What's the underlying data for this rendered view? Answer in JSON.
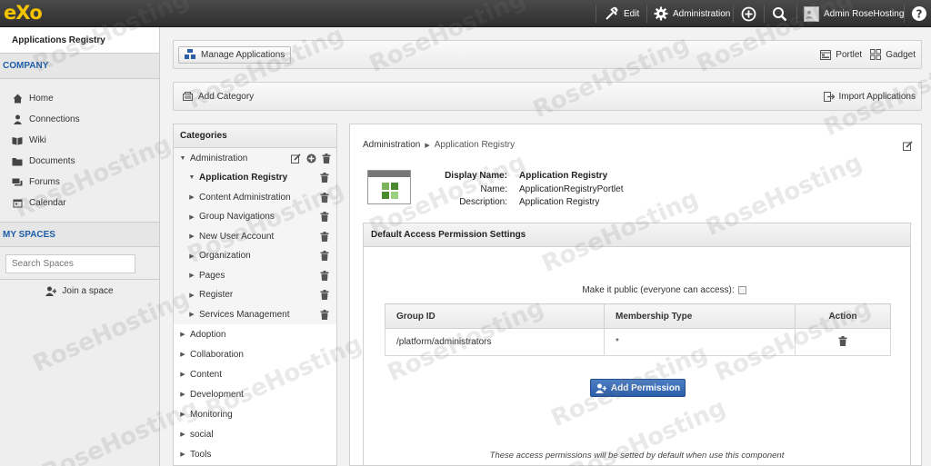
{
  "topbar": {
    "logo": "eXo",
    "edit_label": "Edit",
    "administration_label": "Administration",
    "user_label": "Admin RoseHosting"
  },
  "sidebar": {
    "app_title": "Applications Registry",
    "company_title": "COMPANY",
    "nav_items": [
      {
        "label": "Home",
        "icon": "home-icon"
      },
      {
        "label": "Connections",
        "icon": "user-icon"
      },
      {
        "label": "Wiki",
        "icon": "book-icon"
      },
      {
        "label": "Documents",
        "icon": "folder-icon"
      },
      {
        "label": "Forums",
        "icon": "chat-icon"
      },
      {
        "label": "Calendar",
        "icon": "calendar-icon"
      }
    ],
    "spaces_title": "MY SPACES",
    "search_placeholder": "Search Spaces",
    "join_label": "Join a space"
  },
  "toolbar": {
    "manage_label": "Manage Applications",
    "portlet_label": "Portlet",
    "gadget_label": "Gadget",
    "add_category_label": "Add Category",
    "import_label": "Import Applications"
  },
  "categories": {
    "title": "Categories",
    "expanded": {
      "label": "Administration",
      "children": [
        {
          "label": "Application Registry",
          "selected": true
        },
        {
          "label": "Content Administration"
        },
        {
          "label": "Group Navigations"
        },
        {
          "label": "New User Account"
        },
        {
          "label": "Organization"
        },
        {
          "label": "Pages"
        },
        {
          "label": "Register"
        },
        {
          "label": "Services Management"
        }
      ]
    },
    "collapsed": [
      "Adoption",
      "Collaboration",
      "Content",
      "Development",
      "Monitoring",
      "social",
      "Tools"
    ]
  },
  "detail": {
    "breadcrumb_parent": "Administration",
    "breadcrumb_current": "Application Registry",
    "display_name_label": "Display Name:",
    "display_name": "Application Registry",
    "name_label": "Name:",
    "name": "ApplicationRegistryPortlet",
    "description_label": "Description:",
    "description": "Application Registry",
    "permission_title": "Default Access Permission Settings",
    "public_label": "Make it public (everyone can access):",
    "table": {
      "headers": [
        "Group ID",
        "Membership Type",
        "Action"
      ],
      "rows": [
        {
          "group_id": "/platform/administrators",
          "membership": "*"
        }
      ]
    },
    "add_permission_label": "Add Permission",
    "note": "These access permissions will be setted by default when use this component"
  },
  "colors": {
    "accent_blue": "#2b5ea8",
    "logo_yellow": "#f5c400",
    "topbar": "#3a3a3a"
  }
}
